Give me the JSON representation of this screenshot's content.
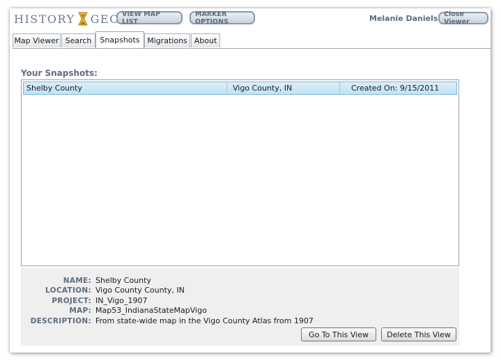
{
  "header": {
    "logo_left": "HISTORY",
    "logo_right": "GEO",
    "view_map_list": "VIEW MAP LIST",
    "marker_options": "MARKER OPTIONS",
    "user_name": "Melanie Daniels",
    "close_viewer": "Close Viewer"
  },
  "tabs": [
    {
      "label": "Map Viewer",
      "active": false
    },
    {
      "label": "Search",
      "active": false
    },
    {
      "label": "Snapshots",
      "active": true
    },
    {
      "label": "Migrations",
      "active": false
    },
    {
      "label": "About",
      "active": false
    }
  ],
  "snapshots": {
    "title": "Your Snapshots:",
    "rows": [
      {
        "name": "Shelby County",
        "location": "Vigo County, IN",
        "created": "Created On: 9/15/2011"
      }
    ]
  },
  "details": {
    "fields": [
      {
        "label": "NAME:",
        "value": "Shelby County"
      },
      {
        "label": "LOCATION:",
        "value": "Vigo County County, IN"
      },
      {
        "label": "PROJECT:",
        "value": "IN_Vigo_1907"
      },
      {
        "label": "MAP:",
        "value": "Map53_IndianaStateMapVigo"
      },
      {
        "label": "DESCRIPTION:",
        "value": "From state-wide map in the Vigo County Atlas from 1907"
      }
    ],
    "go_to_view": "Go To This View",
    "delete_view": "Delete This View"
  },
  "colors": {
    "accent": "#5d6c7e",
    "logo_gold": "#d9a520",
    "row_selected": "#c2e3f4"
  },
  "icons": {
    "logo_mark": "hourglass-icon"
  }
}
